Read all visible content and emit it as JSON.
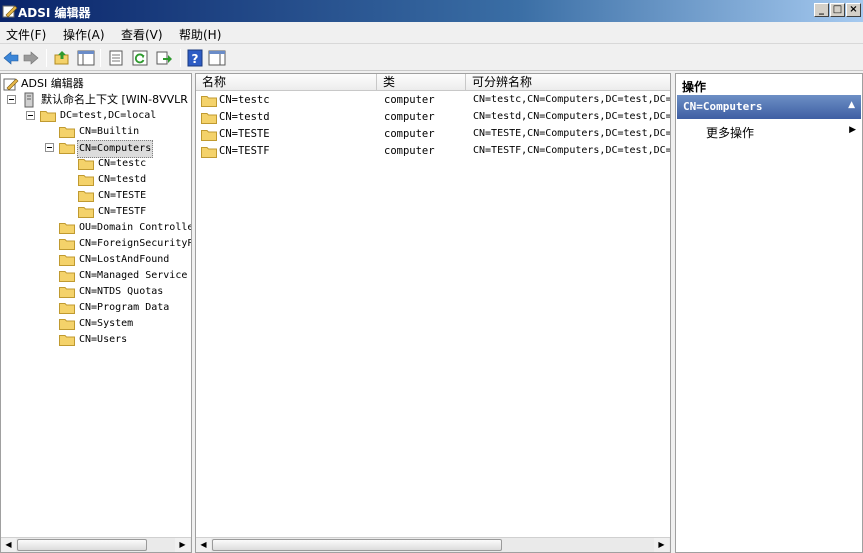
{
  "window": {
    "title": "ADSI 编辑器",
    "minimize": "_",
    "maximize": "□",
    "close": "×"
  },
  "menu": {
    "file": "文件(F)",
    "action": "操作(A)",
    "view": "查看(V)",
    "help": "帮助(H)"
  },
  "tree": {
    "root": "ADSI 编辑器",
    "naming_context": "默认命名上下文 [WIN-8VVLR",
    "domain": "DC=test,DC=local",
    "items": [
      "CN=Builtin",
      "CN=Computers",
      "CN=testc",
      "CN=testd",
      "CN=TESTE",
      "CN=TESTF",
      "OU=Domain Controlle",
      "CN=ForeignSecurityP",
      "CN=LostAndFound",
      "CN=Managed Service",
      "CN=NTDS Quotas",
      "CN=Program Data",
      "CN=System",
      "CN=Users"
    ]
  },
  "list": {
    "headers": [
      "名称",
      "类",
      "可分辨名称"
    ],
    "rows": [
      {
        "name": "CN=testc",
        "class": "computer",
        "dn": "CN=testc,CN=Computers,DC=test,DC="
      },
      {
        "name": "CN=testd",
        "class": "computer",
        "dn": "CN=testd,CN=Computers,DC=test,DC="
      },
      {
        "name": "CN=TESTE",
        "class": "computer",
        "dn": "CN=TESTE,CN=Computers,DC=test,DC="
      },
      {
        "name": "CN=TESTF",
        "class": "computer",
        "dn": "CN=TESTF,CN=Computers,DC=test,DC="
      }
    ]
  },
  "actions": {
    "title": "操作",
    "section": "CN=Computers",
    "more": "更多操作"
  },
  "colors": {
    "folder": "#f4d26a",
    "title_bar": "#0a246a",
    "action_header": "#3e5ea3"
  }
}
